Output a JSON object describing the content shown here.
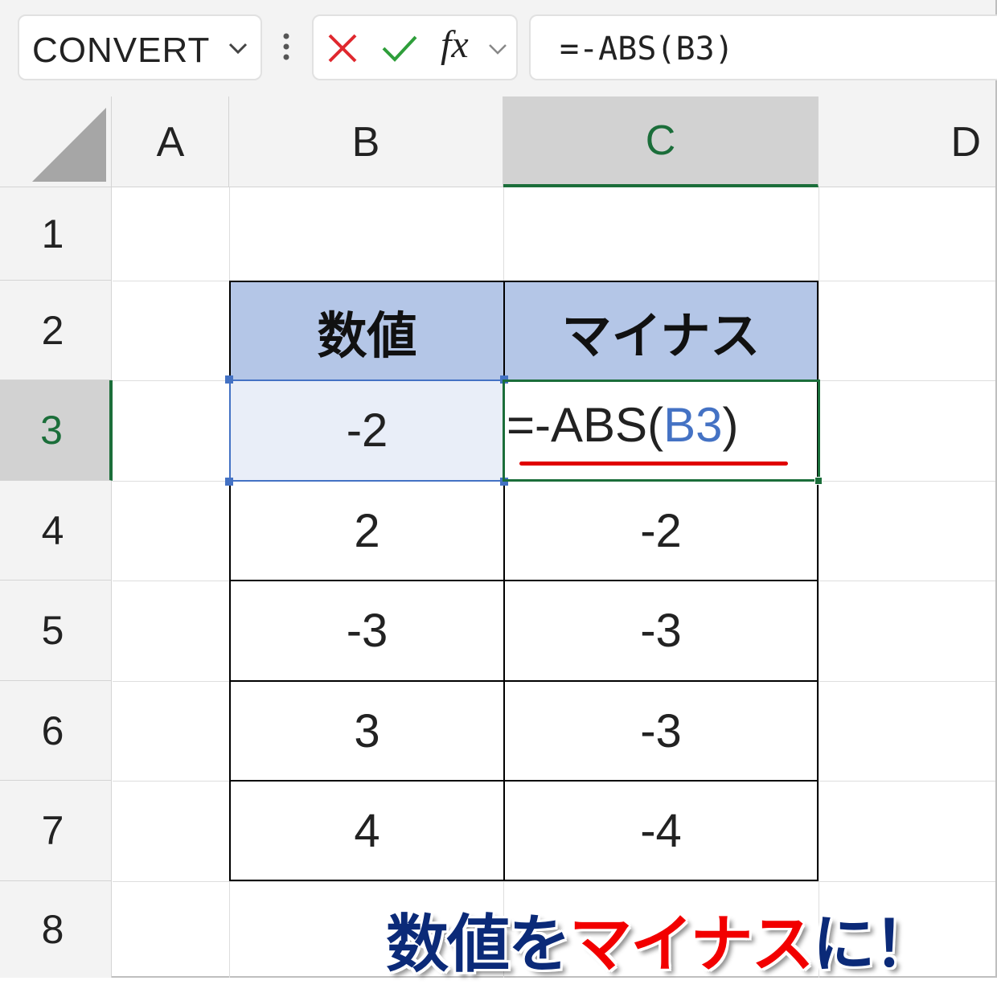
{
  "formula_bar": {
    "name_box": "CONVERT",
    "formula": "=-ABS(B3)"
  },
  "columns": [
    "A",
    "B",
    "C",
    "D"
  ],
  "active_column": "C",
  "rows": [
    "1",
    "2",
    "3",
    "4",
    "5",
    "6",
    "7",
    "8"
  ],
  "active_row": "3",
  "table": {
    "header_value": "数値",
    "header_minus": "マイナス",
    "rows": [
      {
        "value": "-2",
        "minus": "=-ABS(B3)"
      },
      {
        "value": "2",
        "minus": "-2"
      },
      {
        "value": "-3",
        "minus": "-3"
      },
      {
        "value": "3",
        "minus": "-3"
      },
      {
        "value": "4",
        "minus": "-4"
      }
    ]
  },
  "editing_cell": {
    "prefix": "=-ABS(",
    "reference": "B3",
    "suffix": ")"
  },
  "caption": {
    "part1": "数値を",
    "part2": "マイナス",
    "part3": "に！"
  },
  "colors": {
    "active_green": "#1b6e3a",
    "reference_blue": "#4472c4",
    "header_fill": "#b4c6e7",
    "underline_red": "#e00000",
    "caption_navy": "#0b2a78",
    "caption_red": "#f20000"
  },
  "icons": [
    "chevron-down-icon",
    "more-vertical-icon",
    "cancel-icon",
    "enter-check-icon",
    "insert-function-icon",
    "select-all-icon"
  ]
}
